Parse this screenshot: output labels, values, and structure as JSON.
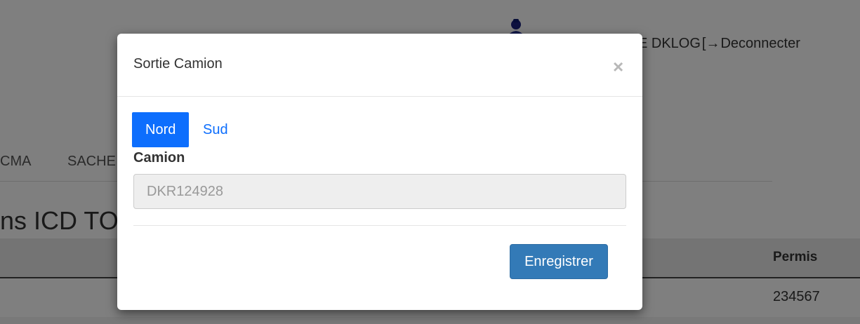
{
  "background": {
    "user_name": "E DKLOG",
    "logout_label": "Deconnecter",
    "nav_tabs": [
      "CMA",
      "SACHE"
    ],
    "page_title": "ns ICD TO",
    "table": {
      "headers": [
        "Permis"
      ],
      "rows": [
        [
          "234567"
        ]
      ]
    }
  },
  "modal": {
    "title": "Sortie Camion",
    "close_symbol": "×",
    "pills": [
      {
        "label": "Nord",
        "active": true
      },
      {
        "label": "Sud",
        "active": false
      }
    ],
    "field_label": "Camion",
    "field_placeholder": "DKR124928",
    "save_label": "Enregistrer"
  },
  "colors": {
    "primary": "#0d6efd",
    "save_button": "#337ab7",
    "backdrop": "#000000"
  },
  "icons": {
    "avatar": "user-avatar-icon",
    "logout": "sign-out-icon"
  }
}
